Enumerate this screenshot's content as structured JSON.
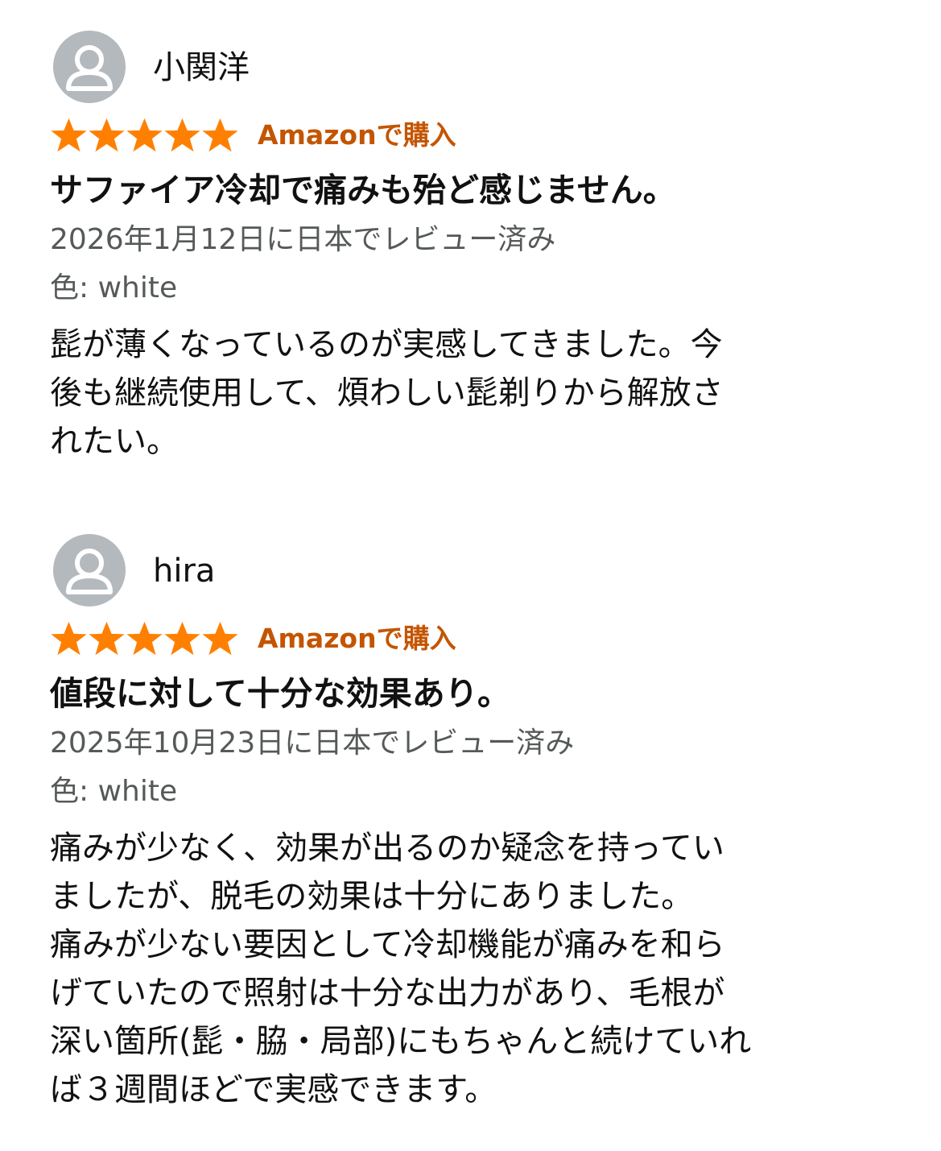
{
  "colors": {
    "star": "#ff8000",
    "verified": "#c45500",
    "meta_text": "#565959",
    "avatar_bg": "#b4b9bd"
  },
  "reviews": [
    {
      "reviewer": "小関洋",
      "avatar_icon": "user-silhouette-icon",
      "rating": 5,
      "rating_max": 5,
      "verified_label": "Amazonで購入",
      "title": "サファイア冷却で痛みも殆ど感じません。",
      "date": "2026年1月12日に日本でレビュー済み",
      "variant": "色: white",
      "body_lines": [
        "髭が薄くなっているのが実感してきました。今",
        "後も継続使用して、煩わしい髭剃りから解放さ",
        "れたい。"
      ]
    },
    {
      "reviewer": "hira",
      "avatar_icon": "user-silhouette-icon",
      "rating": 5,
      "rating_max": 5,
      "verified_label": "Amazonで購入",
      "title": "値段に対して十分な効果あり。",
      "date": "2025年10月23日に日本でレビュー済み",
      "variant": "色: white",
      "body_lines": [
        "痛みが少なく、効果が出るのか疑念を持ってい",
        "ましたが、脱毛の効果は十分にありました。",
        "痛みが少ない要因として冷却機能が痛みを和ら",
        "げていたので照射は十分な出力があり、毛根が",
        "深い箇所(髭・脇・局部)にもちゃんと続けていれ",
        "ば３週間ほどで実感できます。"
      ]
    }
  ]
}
